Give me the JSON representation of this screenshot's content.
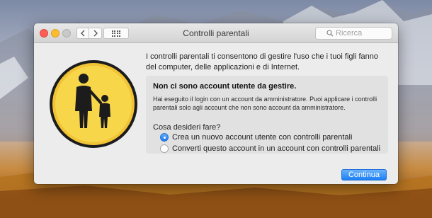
{
  "window": {
    "title": "Controlli parentali",
    "search_placeholder": "Ricerca"
  },
  "toolbar": {
    "back_icon": "chevron-left-icon",
    "forward_icon": "chevron-right-icon",
    "grid_icon": "show-all-grid-icon"
  },
  "content": {
    "intro": "I controlli parentali ti consentono di gestire l'uso che i tuoi figli fanno del computer, delle applicazioni e di Internet.",
    "panel": {
      "title": "Non ci sono account utente da gestire.",
      "text": "Hai eseguito il login con un account da amministratore. Puoi applicare i controlli parentali solo agli account che non sono account da amministratore.",
      "question": "Cosa desideri fare?",
      "options": [
        {
          "label": "Crea un nuovo account utente con controlli parentali",
          "selected": true
        },
        {
          "label": "Converti questo account in un account con controlli parentali",
          "selected": false
        }
      ]
    },
    "continue_label": "Continua"
  },
  "colors": {
    "accent": "#1c80f4",
    "badge_yellow": "#f7cf3b",
    "close": "#fc5f57",
    "minimize": "#fdbc2e"
  }
}
